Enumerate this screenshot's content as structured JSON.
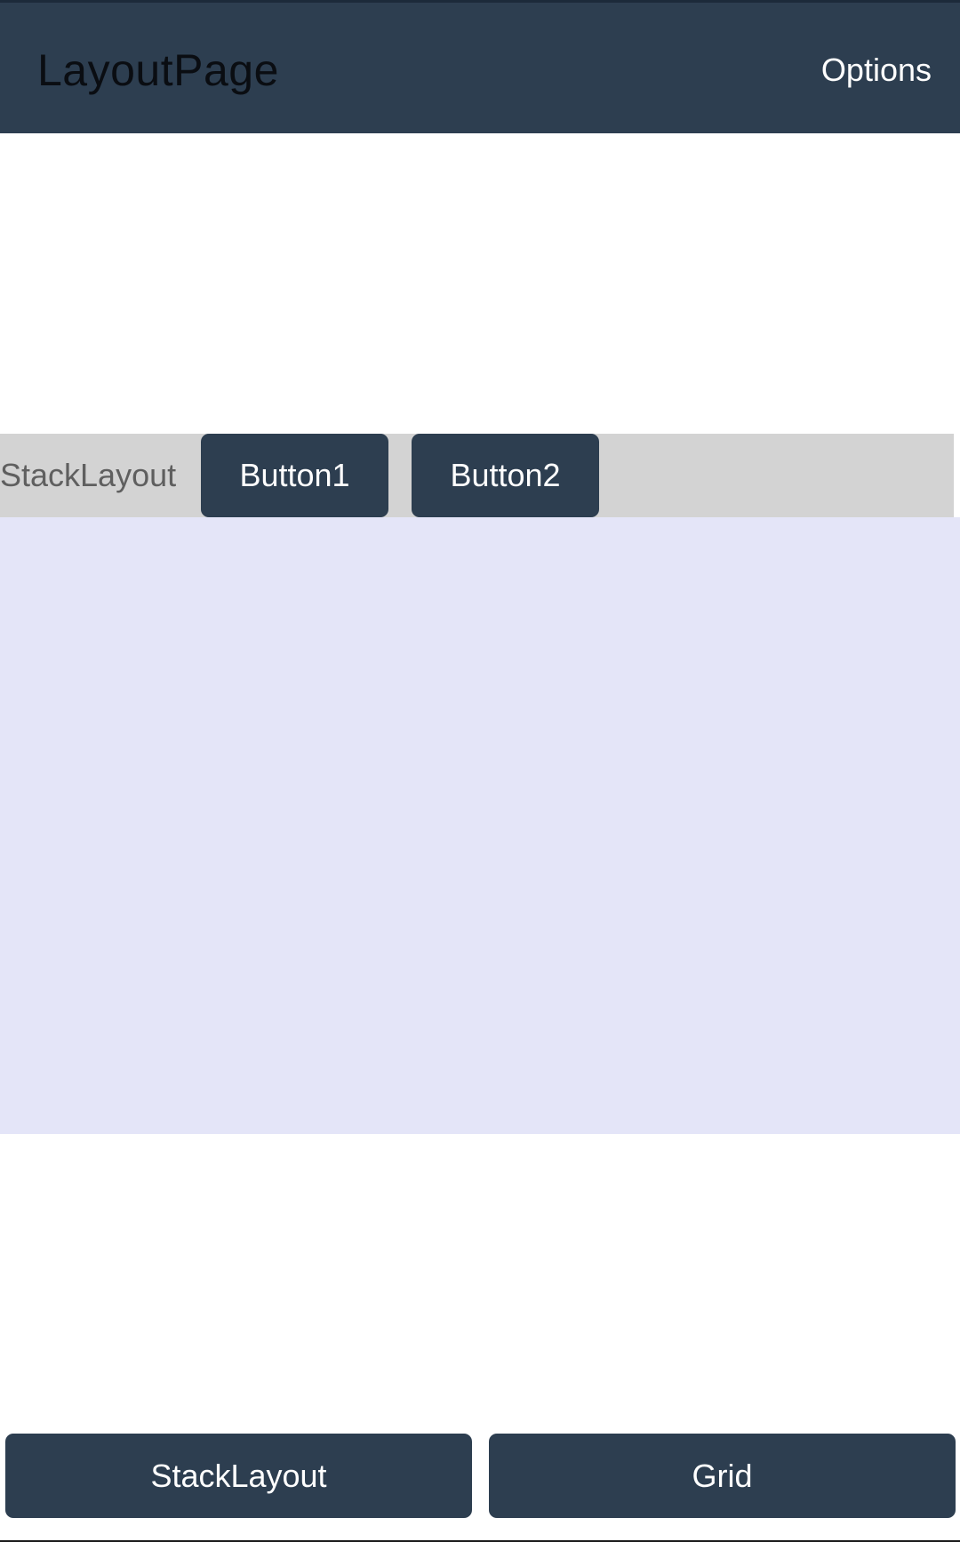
{
  "appbar": {
    "title": "LayoutPage",
    "options_label": "Options"
  },
  "stack": {
    "label": "StackLayout",
    "button1_label": "Button1",
    "button2_label": "Button2"
  },
  "bottom": {
    "stacklayout_label": "StackLayout",
    "grid_label": "Grid"
  },
  "colors": {
    "appbar": "#2d3e50",
    "button": "#2d3e50",
    "stack_row_bg": "#d3d3d3",
    "grid_area_bg": "#e4e5f8"
  }
}
